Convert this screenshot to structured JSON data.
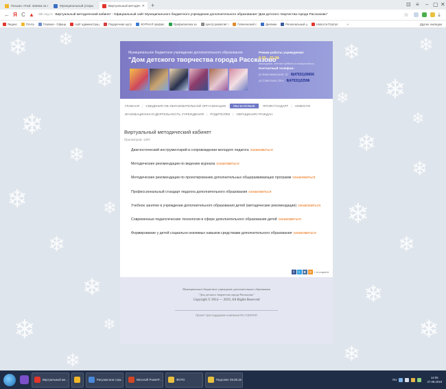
{
  "browser": {
    "tabs": [
      {
        "label": "Письмо «Fwd: Заявка на г",
        "color": "#f1b72b",
        "active": false
      },
      {
        "label": "Муниципальный (откры",
        "color": "#3b6fc4",
        "active": false
      },
      {
        "label": "Виртуальный методич",
        "color": "#e2352c",
        "active": true
      }
    ],
    "new_tab": "+",
    "controls": [
      "⊡",
      "≡",
      "–",
      "▢",
      "✕"
    ],
    "url_host": "ddt.org.ru",
    "url_title": "Виртуальный методический кабинет - Официальный сайт Муниципального бюджетного учреждения дополнительного образования \"Дом детского творчества города Рассказово\"",
    "bookmarks": [
      {
        "label": "Яндекс",
        "color": "#e2352c"
      },
      {
        "label": "Почта",
        "color": "#f1b72b"
      },
      {
        "label": "Главная - Офици",
        "color": "#6b8cc9"
      },
      {
        "label": "сайт администрац",
        "color": "#e2352c"
      },
      {
        "label": "Подарочная шуту",
        "color": "#d43b3b"
      },
      {
        "label": "ЖУРНАЛ профил",
        "color": "#3a7bd5"
      },
      {
        "label": "Профилактика за",
        "color": "#2e9e4d"
      },
      {
        "label": "Центр развития т",
        "color": "#8a8a8a"
      },
      {
        "label": "Гипнический с",
        "color": "#e08a2c"
      },
      {
        "label": "Дневник",
        "color": "#3b6fc4"
      },
      {
        "label": "Региональный ц",
        "color": "#3a5a9c"
      },
      {
        "label": "Новости Портал",
        "color": "#e2352c"
      },
      {
        "label": "»",
        "color": "#ffffff"
      }
    ],
    "bookmarks_other": "Другие закладки"
  },
  "header": {
    "org_line": "Муниципальное бюджетное учреждение дополнительного образования",
    "org_name": "\"Дом детского творчества города Рассказово\"",
    "hours_title": "Режим работы учреждения:",
    "hours": "8.00 - 20.00",
    "weekend": "(выходные, летние субботы и воскресенья)",
    "phone_title": "Контактный телефон:",
    "addresses": [
      {
        "street": "ул.Комсомольская, 11",
        "phone": "8(47531)30656"
      },
      {
        "street": "ул.Советская, 29 а",
        "phone": "8(47531)22596"
      }
    ]
  },
  "nav": {
    "row1": [
      {
        "label": "ГЛАВНАЯ",
        "active": false
      },
      {
        "label": "СВЕДЕНИЯ ОБ ОБРАЗОВАТЕЛЬНОЙ ОРГАНИЗАЦИИ",
        "active": false
      },
      {
        "label": "МЫ БАЗОВЫЕ",
        "active": true
      },
      {
        "label": "ПРОФСТАНДАРТ",
        "active": false
      },
      {
        "label": "НОВОСТИ",
        "active": false
      }
    ],
    "row2": [
      {
        "label": "ИННОВАЦИОННАЯ ДЕЯТЕЛЬНОСТЬ УЧРЕЖДЕНИЯ",
        "active": false
      },
      {
        "label": "РОДИТЕЛЯМ",
        "active": false
      },
      {
        "label": "ОБРАЩЕНИЯ ГРАЖДАН",
        "active": false
      }
    ]
  },
  "page": {
    "title": "Виртуальный методический кабинет",
    "views": "Просмотров: 1297",
    "more_label": "ознакомиться",
    "documents": [
      "Диагностический инструментарий в сопровождении молодого педагога",
      "Методические рекомендации по ведению журнала",
      "Методические рекомендации по проектированию дополнительных общеразвивающих программ",
      "Профессиональный стандарт педагога дополнительного образования",
      "Учебное занятие в учреждении дополнительного образования детей (методические рекомендации)",
      "Современные педагогические технологии в сфере дополнительного образования детей",
      "Формирование у детей социально-значимых навыков средствами дополнительного образования"
    ]
  },
  "share": {
    "buttons": [
      {
        "label": "f",
        "color": "#3b5998"
      },
      {
        "label": "t",
        "color": "#33a2e1"
      },
      {
        "label": "B",
        "color": "#4c75a3"
      },
      {
        "label": "O",
        "color": "#f39224"
      }
    ],
    "label": "+ в соцсети"
  },
  "footer": {
    "line1": "Муниципальное бюджетное учреждение дополнительного образования",
    "line2": "\"Дом детского творчества города Рассказово\"",
    "copyright": "Copyright © 2014 — 2019, All Rights Reserved",
    "credit": "Проект при поддержке компании RU-CENTER"
  },
  "taskbar": {
    "tasks": [
      {
        "label": "Виртуальный ме...",
        "color": "#e2352c"
      },
      {
        "label": "",
        "color": "#f1b72b"
      },
      {
        "label": "Рисунки мои стра...",
        "color": "#4a88d9"
      },
      {
        "label": "Microsoft PowerP...",
        "color": "#d24726"
      },
      {
        "label": "ФОТО",
        "color": "#e9c13e"
      },
      {
        "label": "Педсовет 29.08.18",
        "color": "#e9c13e"
      }
    ],
    "lang": "RU",
    "time": "14:05",
    "date": "27.08.2019"
  }
}
